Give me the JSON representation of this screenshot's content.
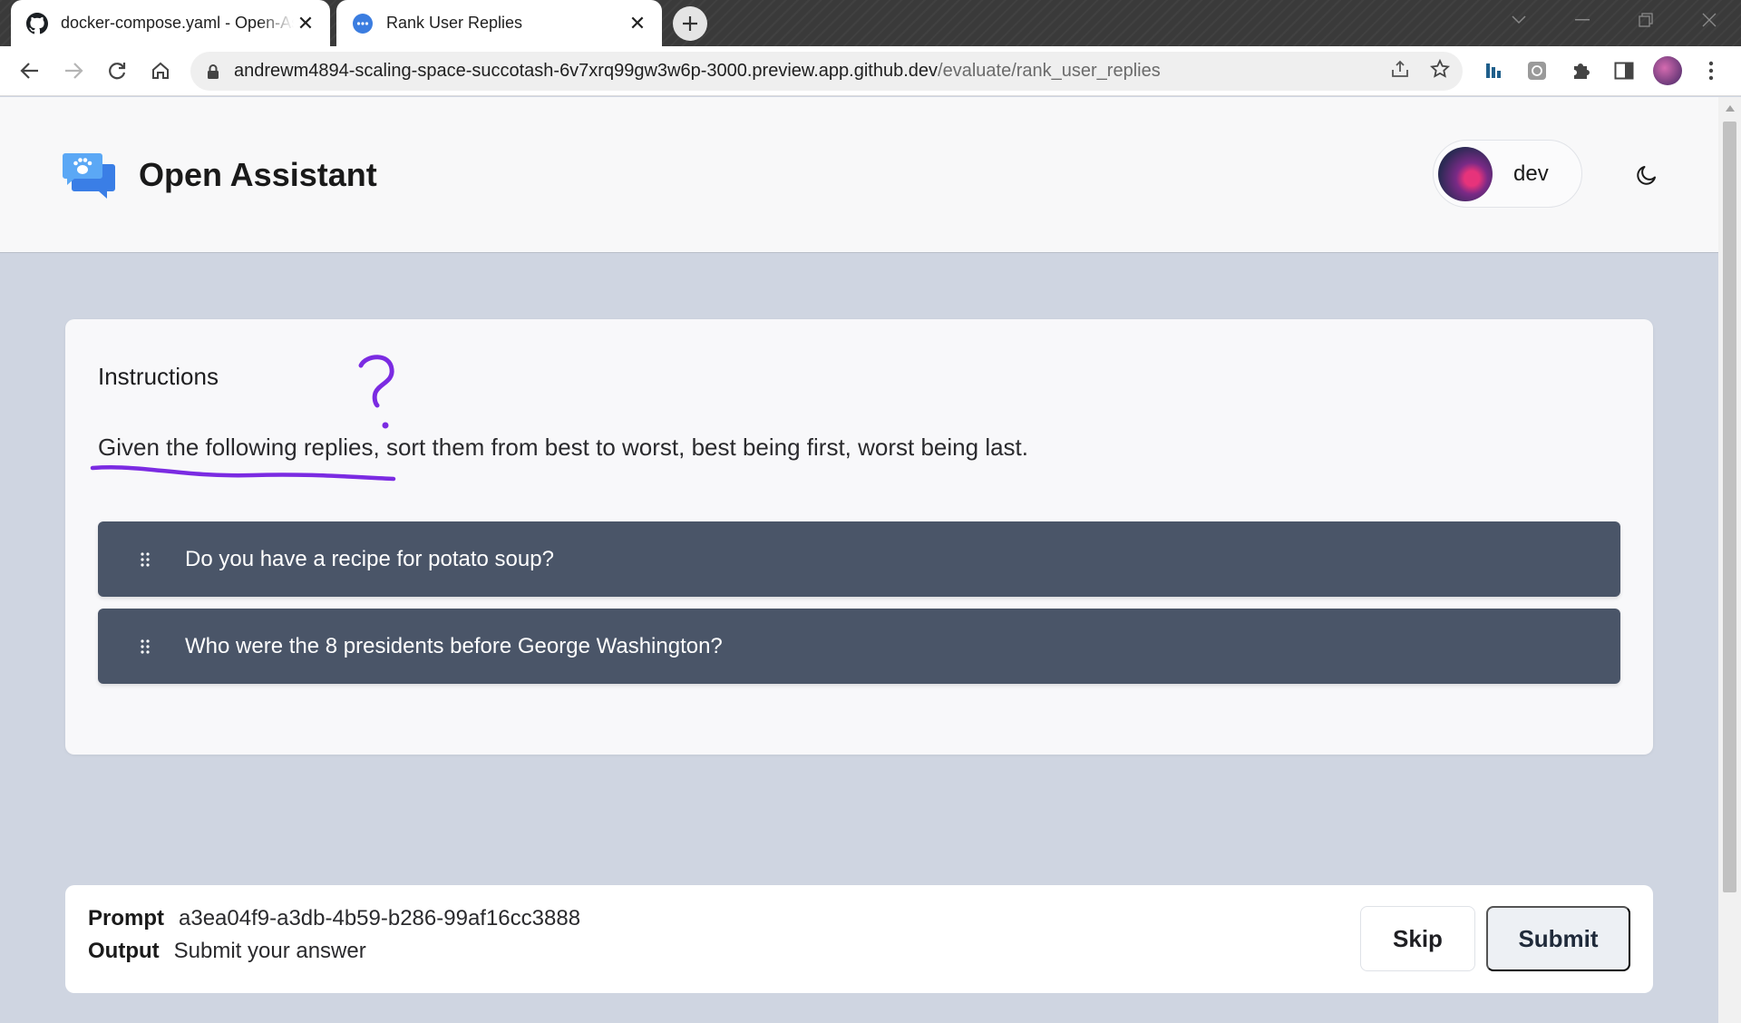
{
  "browser": {
    "tabs": [
      {
        "title": "docker-compose.yaml - Open-Assistant",
        "icon": "github-icon",
        "active": true
      },
      {
        "title": "Rank User Replies",
        "icon": "open-assistant-favicon",
        "active": false
      }
    ],
    "url_host": "andrewm4894-scaling-space-succotash-6v7xrq99gw3w6p-3000.preview.app.github.dev",
    "url_path": "/evaluate/rank_user_replies"
  },
  "header": {
    "brand": "Open Assistant",
    "user_name": "dev"
  },
  "task": {
    "heading": "Instructions",
    "instruction_underlined": "Given the following replies,",
    "instruction_rest": " sort them from best to worst, best being first, worst being last.",
    "replies": [
      "Do you have a recipe for potato soup?",
      "Who were the 8 presidents before George Washington?"
    ]
  },
  "footer": {
    "prompt_label": "Prompt",
    "prompt_value": "a3ea04f9-a3db-4b59-b286-99af16cc3888",
    "output_label": "Output",
    "output_value": "Submit your answer",
    "skip_label": "Skip",
    "submit_label": "Submit"
  },
  "colors": {
    "page_bg": "#cfd5e1",
    "reply_bg": "#4a5568",
    "annotation": "#7b2be2"
  }
}
